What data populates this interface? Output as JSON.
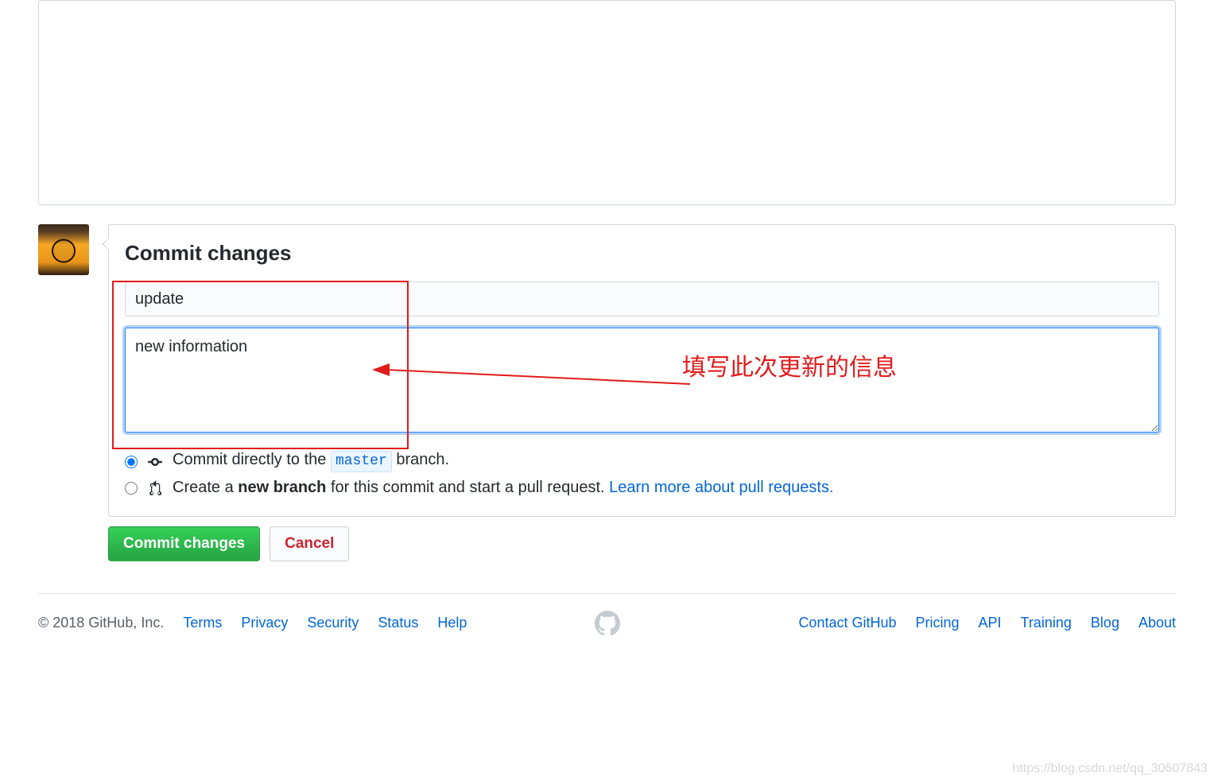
{
  "commit": {
    "heading": "Commit changes",
    "summary_value": "update",
    "description_value": "new information",
    "radio_direct": {
      "prefix": "Commit directly to the ",
      "branch": "master",
      "suffix": " branch."
    },
    "radio_branch": {
      "prefix": "Create a ",
      "bold": "new branch",
      "middle": " for this commit and start a pull request. ",
      "link": "Learn more about pull requests.",
      "link_suffix": ""
    }
  },
  "buttons": {
    "commit": "Commit changes",
    "cancel": "Cancel"
  },
  "footer": {
    "copyright": "© 2018 GitHub, Inc.",
    "left_links": [
      "Terms",
      "Privacy",
      "Security",
      "Status",
      "Help"
    ],
    "right_links": [
      "Contact GitHub",
      "Pricing",
      "API",
      "Training",
      "Blog",
      "About"
    ]
  },
  "annotations": {
    "text": "填写此次更新的信息"
  },
  "watermark": "https://blog.csdn.net/qq_30607843"
}
